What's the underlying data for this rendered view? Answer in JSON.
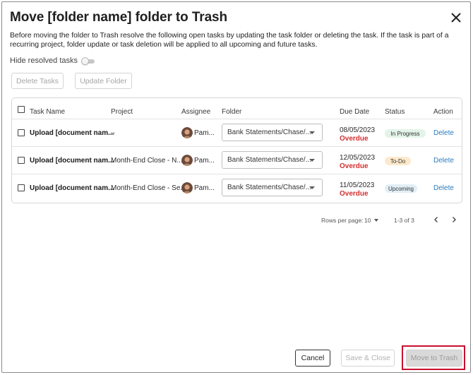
{
  "dialog": {
    "title": "Move [folder name] folder to Trash",
    "description": "Before moving the folder to Trash resolve the following open tasks by updating the task folder or deleting the task. If the task is part of a recurring project, folder update or task deletion will be applied to all upcoming and future tasks."
  },
  "filters": {
    "hide_resolved_label": "Hide resolved tasks",
    "hide_resolved_on": false
  },
  "bulk_actions": {
    "delete_label": "Delete Tasks",
    "update_label": "Update Folder"
  },
  "table": {
    "columns": [
      "Task Name",
      "Project",
      "Assignee",
      "Folder",
      "Due Date",
      "Status",
      "Action"
    ],
    "rows": [
      {
        "task": "Upload [document nam...",
        "project": "–",
        "assignee": "Pam...",
        "folder": "Bank Statements/Chase/...",
        "due_date": "08/05/2023",
        "due_flag": "Overdue",
        "status": "In Progress",
        "action": "Delete"
      },
      {
        "task": "Upload [document nam...",
        "project": "Month-End Close - N...",
        "assignee": "Pam...",
        "folder": "Bank Statements/Chase/...",
        "due_date": "12/05/2023",
        "due_flag": "Overdue",
        "status": "To-Do",
        "action": "Delete"
      },
      {
        "task": "Upload [document nam...",
        "project": "Month-End Close - Se...",
        "assignee": "Pam...",
        "folder": "Bank Statements/Chase/...",
        "due_date": "11/05/2023",
        "due_flag": "Overdue",
        "status": "Upcoming",
        "action": "Delete"
      }
    ]
  },
  "pagination": {
    "rows_per_page_label": "Rows per page:",
    "rows_per_page": "10",
    "range": "1-3 of 3"
  },
  "footer": {
    "cancel_label": "Cancel",
    "save_close_label": "Save & Close",
    "move_label": "Move to Trash"
  },
  "colors": {
    "overdue": "#d32f2f",
    "link": "#2b7bbd",
    "status_in_progress": "#e3f3e8",
    "status_todo": "#fde9cc",
    "status_upcoming": "#e1eef6",
    "highlight": "#c8102e"
  }
}
